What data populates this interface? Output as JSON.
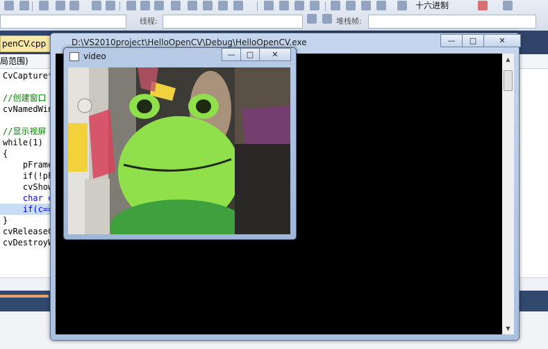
{
  "ide": {
    "hex_label": "十六进制",
    "thread_label": "线程:",
    "stack_label": "堆栈帧:",
    "file_tab": "penCV.cpp",
    "scope": "局范围)",
    "code_lines": [
      "CvCapture*",
      "",
      "//创建窗口",
      "cvNamedWin",
      "",
      "//显示视屏",
      "while(1)",
      "{",
      "    pFrame",
      "    if(!pF",
      "    cvShow",
      "    char c",
      "    if(c==",
      "}",
      "cvReleaseC",
      "cvDestroyW"
    ]
  },
  "console": {
    "title": "D:\\VS2010project\\HelloOpenCV\\Debug\\HelloOpenCV.exe",
    "minimize": "—",
    "maximize": "□",
    "close": "✕"
  },
  "video": {
    "title": "video",
    "minimize": "—",
    "maximize": "□",
    "close": "✕"
  },
  "colors": {
    "console_bg": "#000000",
    "frog_green": "#8fe04a"
  }
}
